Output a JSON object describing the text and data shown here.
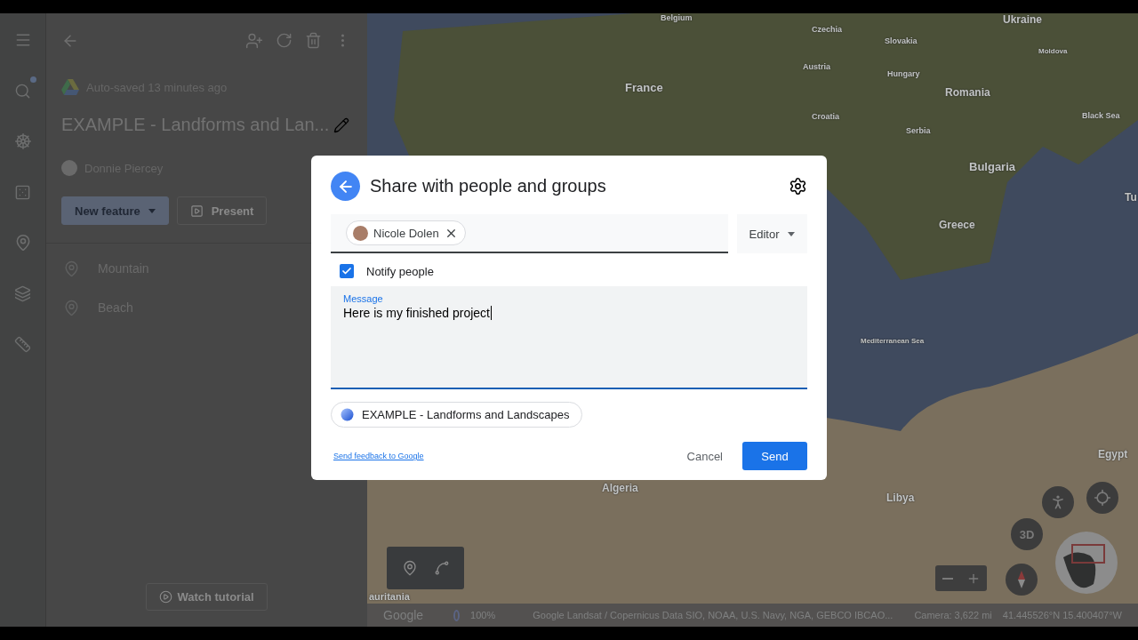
{
  "panel": {
    "autosave": "Auto-saved 13 minutes ago",
    "title": "EXAMPLE - Landforms and Lan...",
    "author": "Donnie Piercey",
    "buttons": [
      {
        "label": "New feature",
        "kind": "dropdown"
      },
      {
        "label": "Present",
        "kind": "outline"
      }
    ],
    "features": [
      {
        "label": "Mountain"
      },
      {
        "label": "Beach"
      }
    ],
    "tutorial": "Watch tutorial"
  },
  "map": {
    "labels": [
      {
        "text": "Belgium"
      },
      {
        "text": "Ukraine"
      },
      {
        "text": "Czechia"
      },
      {
        "text": "Slovakia"
      },
      {
        "text": "Moldova"
      },
      {
        "text": "Austria"
      },
      {
        "text": "Hungary"
      },
      {
        "text": "France"
      },
      {
        "text": "Romania"
      },
      {
        "text": "Croatia"
      },
      {
        "text": "Black Sea"
      },
      {
        "text": "Serbia"
      },
      {
        "text": "Bulgaria"
      },
      {
        "text": "Tu"
      },
      {
        "text": "Greece"
      },
      {
        "text": "Mediterranean Sea"
      },
      {
        "text": "Egypt"
      },
      {
        "text": "Algeria"
      },
      {
        "text": "Libya"
      },
      {
        "text": "auritania"
      }
    ],
    "view_toggle": "3D",
    "footer": {
      "logo": "Google",
      "opacity": "100%",
      "attribution": "Google  Landsat / Copernicus  Data SIO, NOAA, U.S. Navy, NGA, GEBCO  IBCAO...",
      "camera": "Camera: 3,622 mi",
      "coordinates": "41.445526°N 15.400407°W"
    }
  },
  "dialog": {
    "title": "Share with people and groups",
    "recipient": "Nicole Dolen",
    "role": "Editor",
    "notify": {
      "label": "Notify people",
      "checked": true
    },
    "message": {
      "label": "Message",
      "value": "Here is my finished project"
    },
    "item": "EXAMPLE - Landforms and Landscapes",
    "feedback_link": "Send feedback to Google",
    "cancel": "Cancel",
    "send": "Send"
  }
}
